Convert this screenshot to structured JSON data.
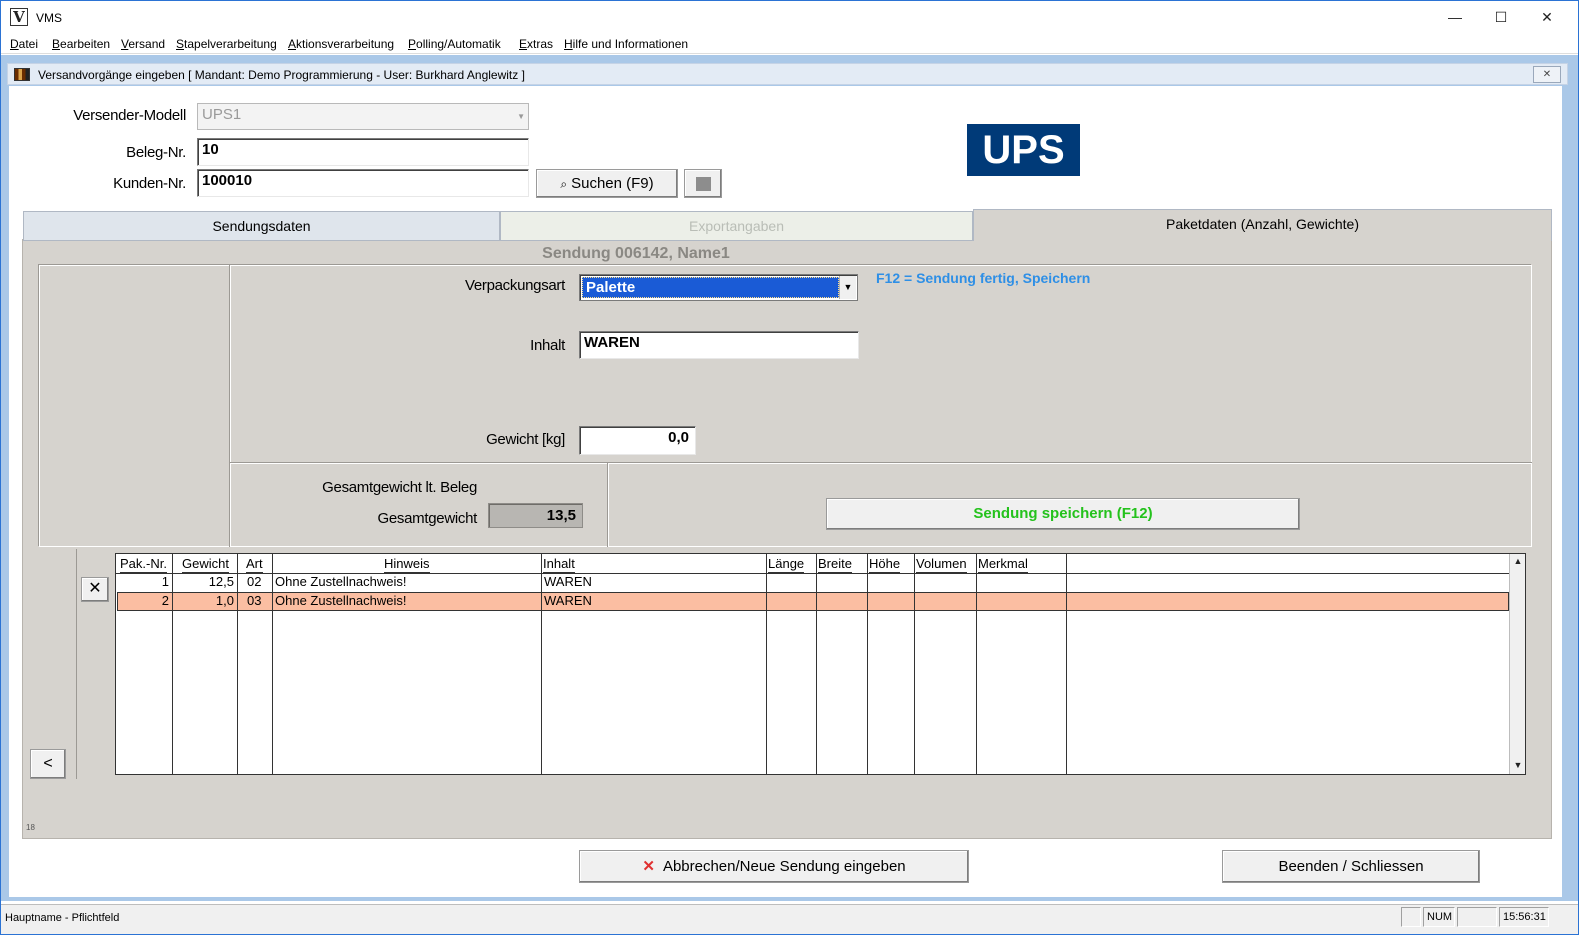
{
  "window": {
    "title": "VMS",
    "logo_letter": "V",
    "minimize": "—",
    "maximize": "☐",
    "close": "✕"
  },
  "menu": [
    "Datei",
    "Bearbeiten",
    "Versand",
    "Stapelverarbeitung",
    "Aktionsverarbeitung",
    "Polling/Automatik",
    "Extras",
    "Hilfe und Informationen"
  ],
  "child_window": {
    "caption": "Versandvorgänge eingeben  [  Mandant:  Demo Programmierung - User:  Burkhard Anglewitz ]",
    "close": "✕"
  },
  "header_form": {
    "versender_label": "Versender-Modell",
    "versender_value": "UPS1",
    "beleg_label": "Beleg-Nr.",
    "beleg_value": "10",
    "kunden_label": "Kunden-Nr.",
    "kunden_value": "100010",
    "search_button": "Suchen (F9)",
    "logo_text": "UPS"
  },
  "tabs": [
    "Sendungsdaten",
    "Exportangaben",
    "Paketdaten (Anzahl, Gewichte)"
  ],
  "sendung_header": "Sendung 006142,  Name1",
  "hint": "F12 = Sendung fertig, Speichern",
  "fields": {
    "verpackungsart_label": "Verpackungsart",
    "verpackungsart_value": "Palette",
    "inhalt_label": "Inhalt",
    "inhalt_value": "WAREN",
    "gewicht_label": "Gewicht [kg]",
    "gewicht_value": "0,0",
    "gesamt_beleg_label": "Gesamtgewicht lt. Beleg",
    "gesamt_label": "Gesamtgewicht",
    "gesamt_value": "13,5"
  },
  "save_button": "Sendung speichern  (F12)",
  "grid": {
    "columns": [
      "Pak.-Nr.",
      "Gewicht",
      "Art",
      "Hinweis",
      "Inhalt",
      "Länge",
      "Breite",
      "Höhe",
      "Volumen",
      "Merkmal"
    ],
    "rows": [
      {
        "paknr": "1",
        "gewicht": "12,5",
        "art": "02",
        "hinweis": "Ohne Zustellnachweis!",
        "inhalt": "WAREN"
      },
      {
        "paknr": "2",
        "gewicht": "1,0",
        "art": "03",
        "hinweis": "Ohne Zustellnachweis!",
        "inhalt": "WAREN"
      }
    ],
    "selected_row": 1
  },
  "delete_button": "✕",
  "back_button": "<",
  "small_number": "18",
  "cancel_button": "Abbrechen/Neue Sendung eingeben",
  "close_button": "Beenden / Schliessen",
  "status": {
    "text": "Hauptname - Pflichtfeld",
    "num": "NUM",
    "time": "15:56:31"
  }
}
